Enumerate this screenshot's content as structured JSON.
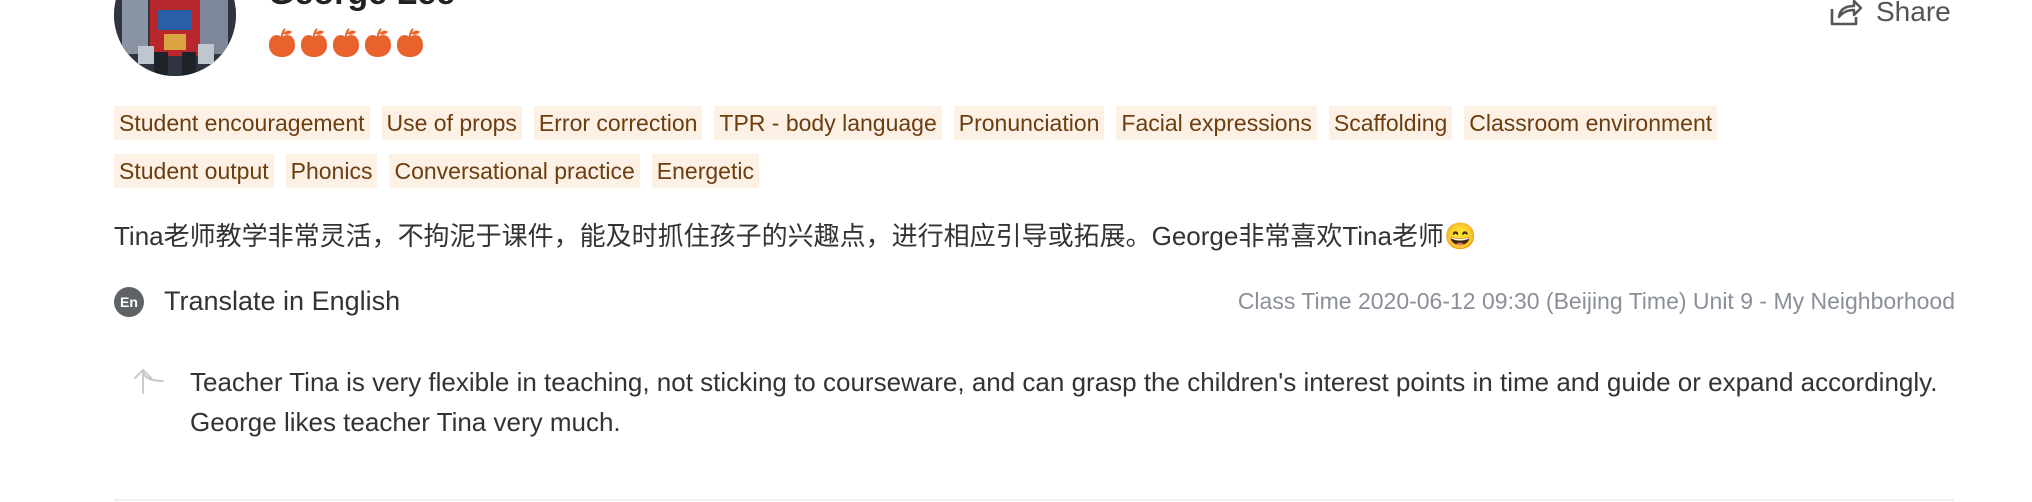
{
  "review": {
    "reviewer_name": "George Lee",
    "rating": 5,
    "rating_max": 5,
    "rating_icon": "peach-icon",
    "rating_color": "#e8622c",
    "share_label": "Share",
    "tags_row1": [
      "Student encouragement",
      "Use of props",
      "Error correction",
      "TPR - body language",
      "Pronunciation",
      "Facial expressions",
      "Scaffolding",
      "Classroom environment"
    ],
    "tags_row2": [
      "Student output",
      "Phonics",
      "Conversational practice",
      "Energetic"
    ],
    "comment": "Tina老师教学非常灵活，不拘泥于课件，能及时抓住孩子的兴趣点，进行相应引导或拓展。George非常喜欢Tina老师😄",
    "translate_badge": "En",
    "translate_label": "Translate in English",
    "class_time": "Class Time 2020-06-12 09:30 (Beijing Time) Unit 9 - My Neighborhood",
    "translation": "Teacher Tina is very flexible in teaching, not sticking to courseware, and can grasp the children's interest points in time and guide or expand accordingly. George likes teacher Tina very much."
  },
  "colors": {
    "tag_background": "#fdf0e4",
    "tag_text": "#6b3d0f",
    "secondary_text": "#8a8f99"
  }
}
